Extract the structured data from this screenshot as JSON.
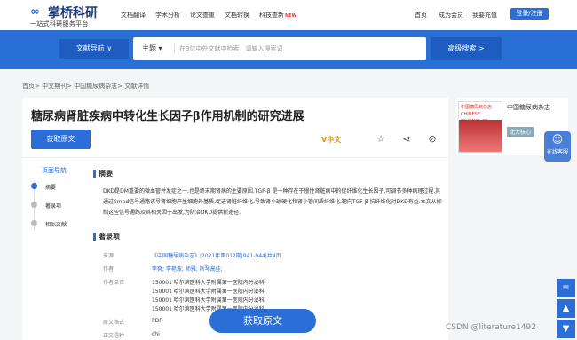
{
  "header": {
    "logo_mark": "∞",
    "logo_title": "掌桥科研",
    "logo_sub": "一站式科研服务平台",
    "nav": [
      "文档翻译",
      "学术分析",
      "论文查重",
      "文档转换",
      "科技查新"
    ],
    "new_badge": "NEW",
    "right_links": [
      "首页",
      "成为会员",
      "我要充值"
    ],
    "login_label": "登录/注册"
  },
  "banner": {
    "nav_button": "文献导航 ∨",
    "search_select": "主题 ▾",
    "search_placeholder": "在3亿中外文献中检索，请输入搜索词",
    "advanced_search": "高级搜索 >"
  },
  "breadcrumb": "首页> 中文期刊> 中国糖尿病杂志> 文献详情",
  "article": {
    "title": "糖尿病肾脏疾病中转化生长因子β作用机制的研究进展",
    "get_button": "获取原文",
    "vlogo": "V中文",
    "icons": [
      "star-icon",
      "share-icon",
      "link-icon"
    ]
  },
  "side_nav": {
    "title": "页面导航",
    "items": [
      "摘要",
      "著录项",
      "相似文献"
    ]
  },
  "abstract": {
    "heading": "摘要",
    "text": "DKD是DM重要的微血管并发症之一,也是终末期肾病的主要原因.TGF-β 是一种存在于慢性肾脏病中的促纤维化生长因子,可调节多种病理过程,其通过Smad信号通路诱导肾细胞产生细胞外基质,促进肾脏纤维化,导致肾小球硬化和肾小管间质纤维化,靶向TGF-β 抗纤维化对DKD有益.本文从抑制这些信号通路及其相关因子出发,为防治DKD提供新途径."
  },
  "records": {
    "heading": "著录项",
    "rows": [
      {
        "key": "来源",
        "value": "《中国糖尿病杂志》|2021年第012期|941-944|共4页"
      },
      {
        "key": "作者",
        "value": "李爽; 李艳波; 师雅; 斯琴高娃;"
      },
      {
        "key": "作者单位",
        "value": "150001 哈尔滨医科大学附属第一医院内分泌科;"
      },
      {
        "key": "",
        "value": "150001 哈尔滨医科大学附属第一医院内分泌科;"
      },
      {
        "key": "",
        "value": "150001 哈尔滨医科大学附属第一医院内分泌科;"
      },
      {
        "key": "",
        "value": "150001 哈尔滨医科大学附属第一医院内分泌科;"
      },
      {
        "key": "原文格式",
        "value": "PDF"
      },
      {
        "key": "正文语种",
        "value": "chi"
      }
    ]
  },
  "float_button": "获取原文",
  "journal": {
    "cover_text": "中国糖尿病杂志 CHINESE JOURNAL OF DIABETES",
    "name": "中国糖尿病杂志",
    "tag": "北大核心"
  },
  "customer_service": "在线客服",
  "side_buttons": [
    "≡",
    "▲",
    "▼"
  ],
  "watermark": "CSDN @literature1492"
}
